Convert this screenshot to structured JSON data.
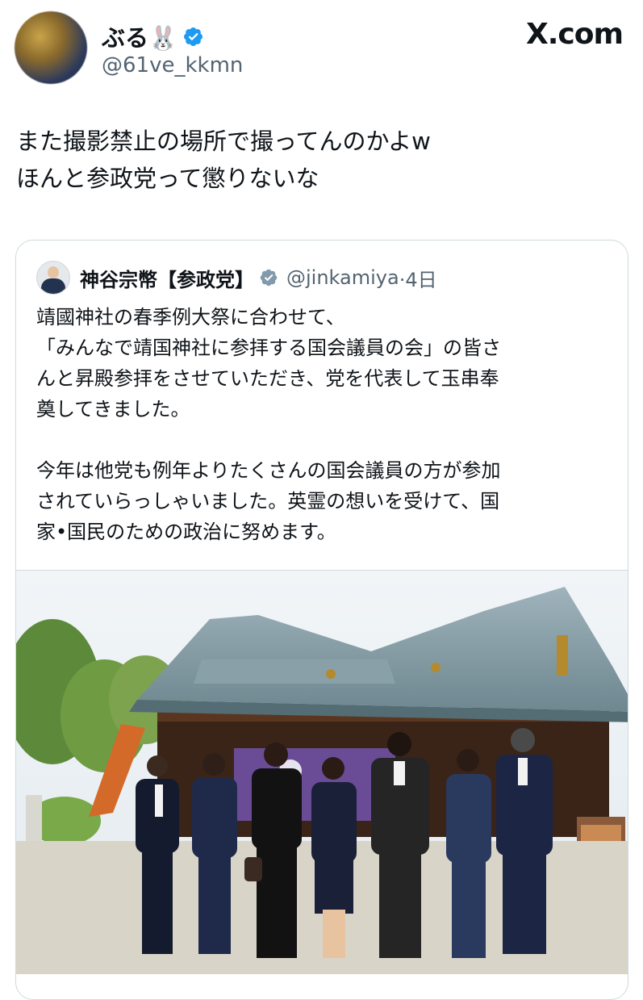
{
  "author": {
    "name": "ぶる🐰",
    "handle": "@61ve_kkmn",
    "verified": true,
    "avatar_icon": "blurred-avatar"
  },
  "brand": "X.com",
  "tweet": {
    "lines": [
      "また撮影禁止の場所で撮ってんのかよw",
      "ほんと参政党って懲りないな"
    ]
  },
  "quote": {
    "name": "神谷宗幣【参政党】",
    "handle": "@jinkamiya",
    "time": "·4日",
    "verified": true,
    "paragraph1": [
      "靖國神社の春季例大祭に合わせて、",
      "「みんなで靖国神社に参拝する国会議員の会」の皆さ",
      "んと昇殿参拝をさせていただき、党を代表して玉串奉",
      "奠してきました。"
    ],
    "paragraph2": [
      "今年は他党も例年よりたくさんの国会議員の方が参加",
      "されていらっしゃいました。英霊の想いを受けて、国",
      "家•国民のための政治に努めます。"
    ],
    "photo_icon": "shrine-group-photo"
  },
  "colors": {
    "verified_blue": "#1d9bf0",
    "verified_gray": "#829aab",
    "secondary_text": "#536471",
    "border": "#cfd9de"
  }
}
